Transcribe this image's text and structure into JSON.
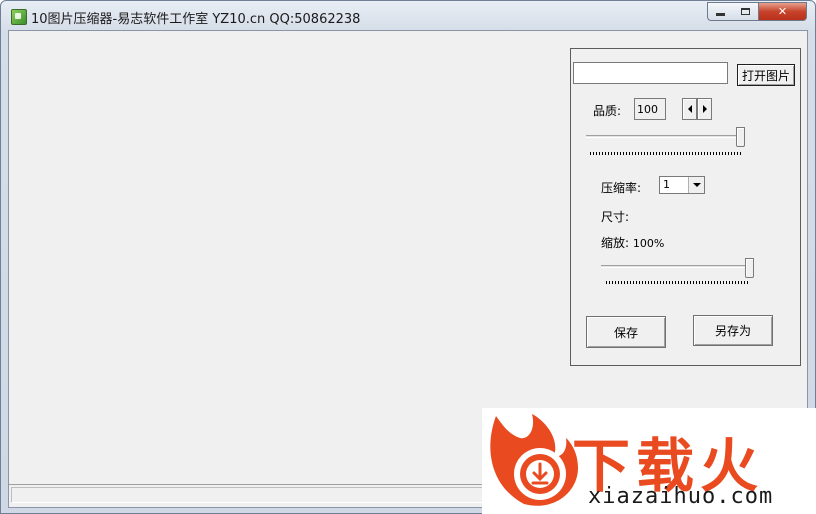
{
  "window": {
    "title": "10图片压缩器-易志软件工作室 YZ10.cn    QQ:50862238",
    "close_label": "✕"
  },
  "panel": {
    "file_path_value": "",
    "open_button_label": "打开图片",
    "quality_label": "品质:",
    "quality_value": "100",
    "quality_slider_level": 1.0,
    "compression_label": "压缩率:",
    "compression_value": "1",
    "size_label": "尺寸:",
    "zoom_label": "缩放:",
    "zoom_value": "100%",
    "zoom_slider_level": 1.0,
    "save_button_label": "保存",
    "save_as_button_label": "另存为"
  },
  "watermark": {
    "brand": "下载火",
    "url": "xiazaihuo.com",
    "brand_color": "#e94a1f"
  }
}
